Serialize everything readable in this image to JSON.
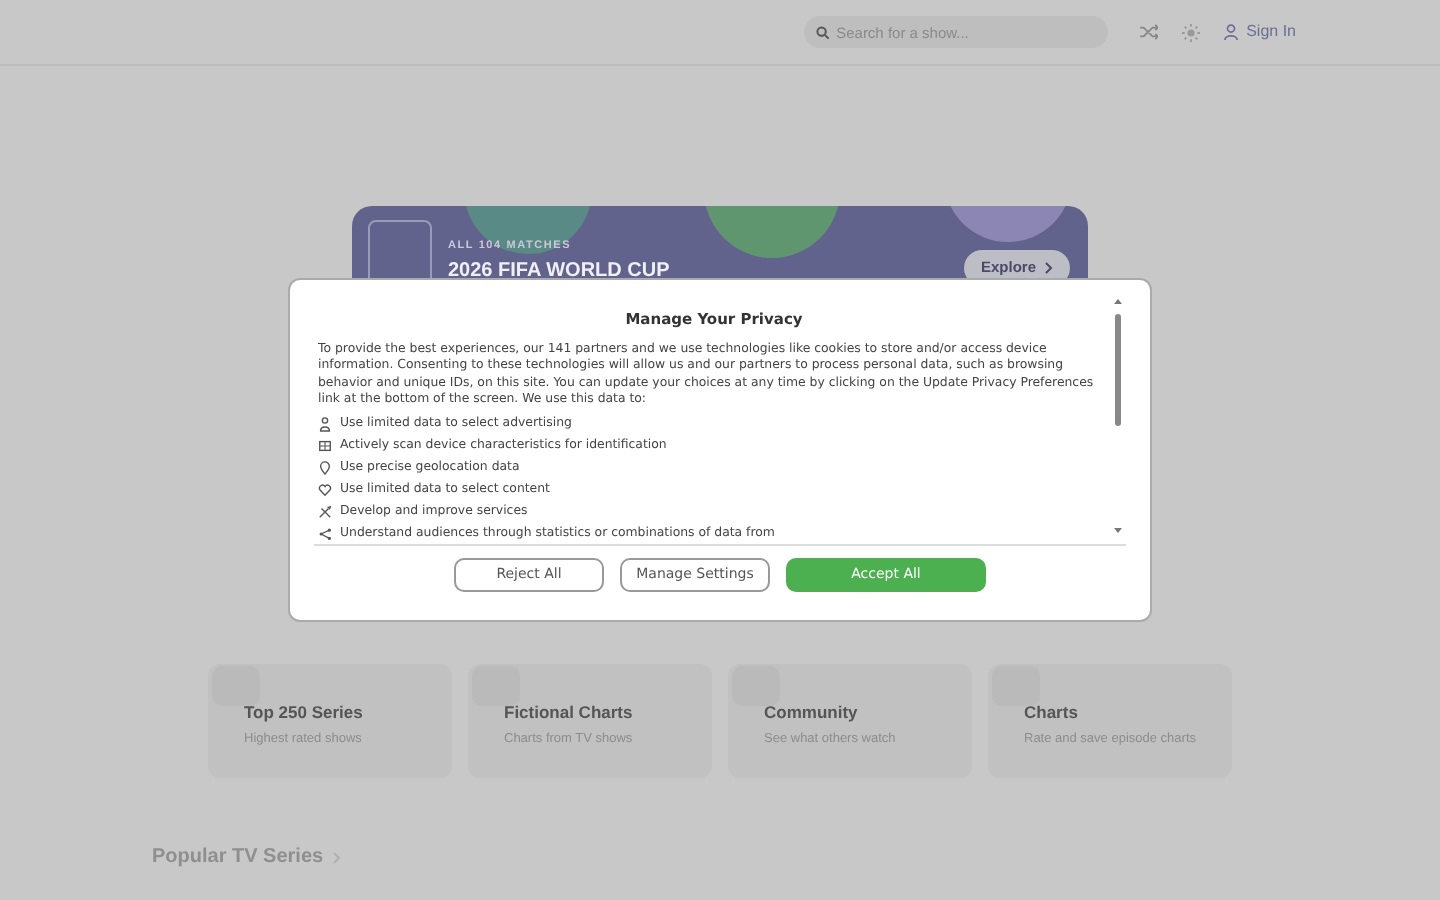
{
  "header": {
    "search": {
      "placeholder": "Search for a show..."
    },
    "sign_in": "Sign In"
  },
  "banner": {
    "eyebrow": "ALL 104 MATCHES",
    "title": "2026 FIFA WORLD CUP",
    "button": "Explore"
  },
  "privacy_dialog": {
    "title": "Manage Your Privacy",
    "intro": "To provide the best experiences, our 141 partners and we use technologies like cookies to store and/or access device information. Consenting to these technologies will allow us and our partners to process personal data, such as browsing behavior and unique IDs, on this site. You can update your choices at any time by clicking on the Update Privacy Preferences link at the bottom of the screen. We use this data to:",
    "purposes": [
      {
        "kind": "person",
        "text": "Use limited data to select advertising"
      },
      {
        "kind": "device",
        "text": "Actively scan device characteristics for identification"
      },
      {
        "kind": "pin",
        "text": "Use precise geolocation data"
      },
      {
        "kind": "heart",
        "text": "Use limited data to select content"
      },
      {
        "kind": "tools",
        "text": "Develop and improve services"
      },
      {
        "kind": "share",
        "text": "Understand audiences through statistics or combinations of data from"
      }
    ],
    "buttons": [
      {
        "label": "Reject All",
        "kind": "outline"
      },
      {
        "label": "Manage Settings",
        "kind": "outline"
      },
      {
        "label": "Accept All",
        "kind": "primary"
      }
    ]
  },
  "feature_cards": [
    {
      "title": "Top 250 Series",
      "subtitle": "Highest rated shows"
    },
    {
      "title": "Fictional Charts",
      "subtitle": "Charts from TV shows"
    },
    {
      "title": "Community",
      "subtitle": "See what others watch"
    },
    {
      "title": "Charts",
      "subtitle": "Rate and save episode charts"
    }
  ],
  "section": {
    "title": "Popular TV Series"
  }
}
